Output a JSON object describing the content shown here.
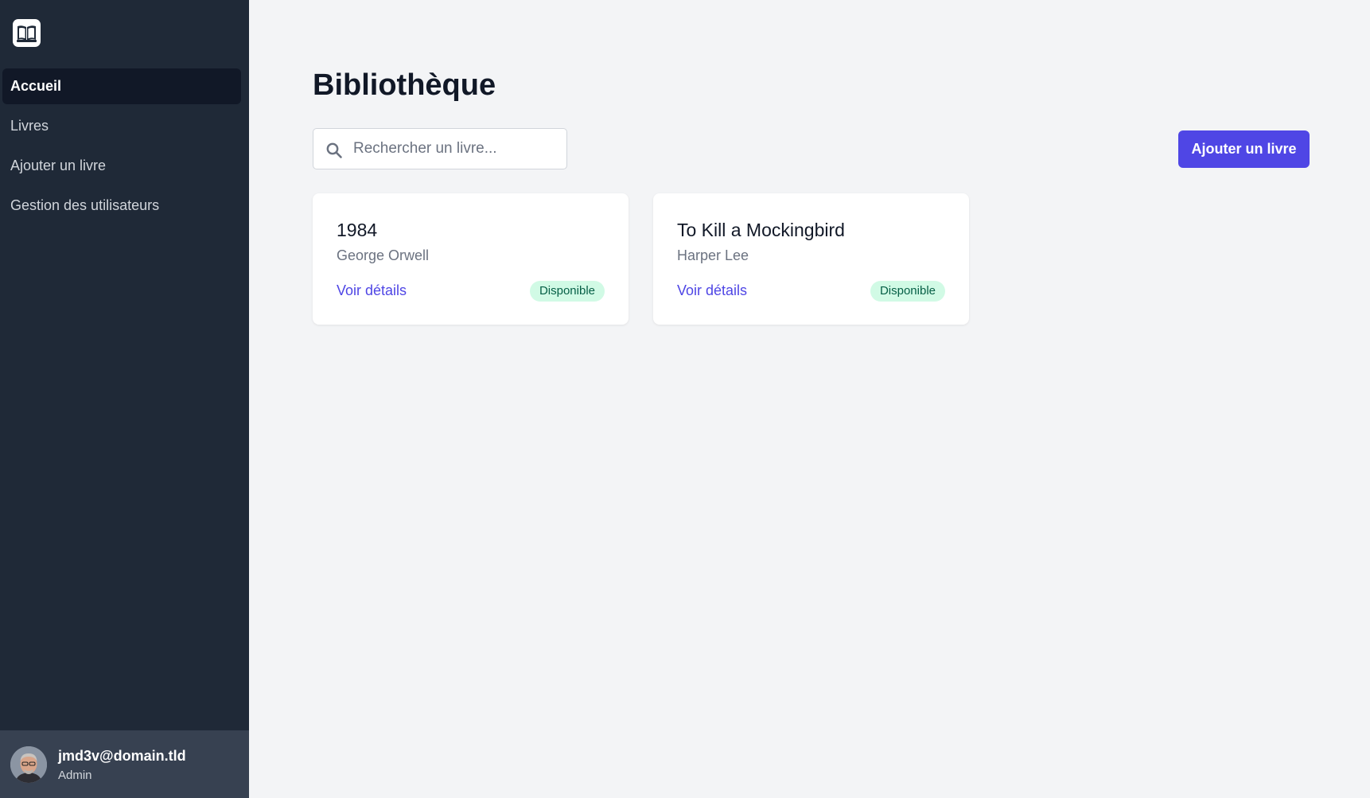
{
  "sidebar": {
    "logo_icon": "book-open-icon",
    "nav": [
      {
        "label": "Accueil",
        "active": true
      },
      {
        "label": "Livres",
        "active": false
      },
      {
        "label": "Ajouter un livre",
        "active": false
      },
      {
        "label": "Gestion des utilisateurs",
        "active": false
      }
    ],
    "user": {
      "email": "jmd3v@domain.tld",
      "role": "Admin"
    }
  },
  "main": {
    "title": "Bibliothèque",
    "search": {
      "placeholder": "Rechercher un livre...",
      "value": "",
      "icon": "search-icon"
    },
    "add_button_label": "Ajouter un livre",
    "books": [
      {
        "title": "1984",
        "author": "George Orwell",
        "link_label": "Voir détails",
        "status": "Disponible"
      },
      {
        "title": "To Kill a Mockingbird",
        "author": "Harper Lee",
        "link_label": "Voir détails",
        "status": "Disponible"
      }
    ]
  },
  "colors": {
    "sidebar_bg": "#1f2937",
    "sidebar_active_bg": "#111827",
    "user_box_bg": "#374151",
    "page_bg": "#f3f4f6",
    "accent": "#4f46e5",
    "badge_bg": "#d1fae5",
    "badge_text": "#065f46"
  }
}
